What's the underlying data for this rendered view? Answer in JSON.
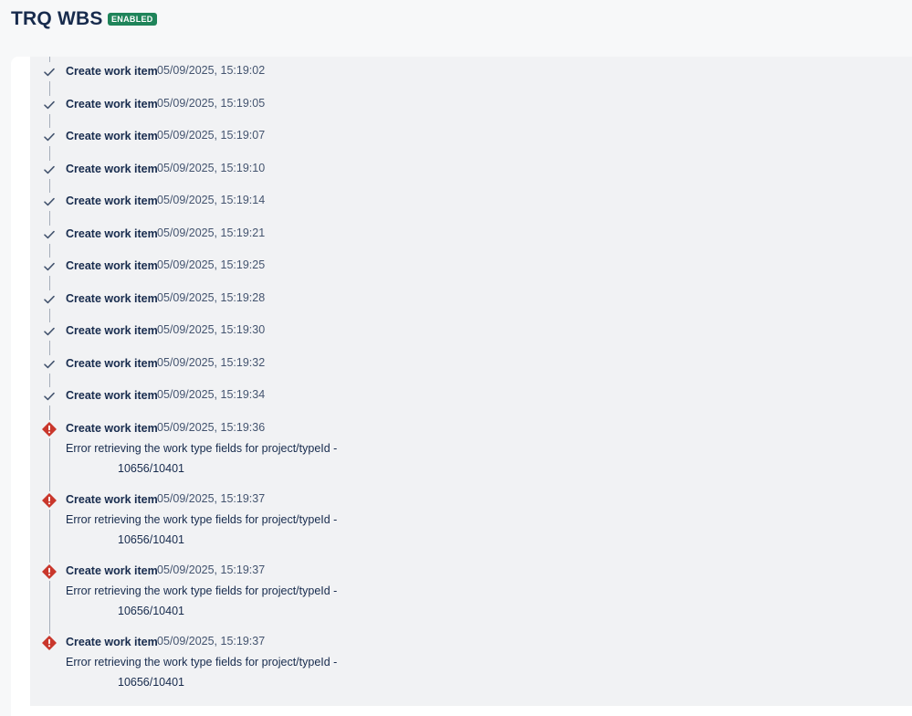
{
  "header": {
    "title": "TRQ WBS",
    "status": "ENABLED"
  },
  "log": {
    "entries": [
      {
        "status": "success",
        "action": "Create work item",
        "timestamp": "05/09/2025, 15:19:02"
      },
      {
        "status": "success",
        "action": "Create work item",
        "timestamp": "05/09/2025, 15:19:05"
      },
      {
        "status": "success",
        "action": "Create work item",
        "timestamp": "05/09/2025, 15:19:07"
      },
      {
        "status": "success",
        "action": "Create work item",
        "timestamp": "05/09/2025, 15:19:10"
      },
      {
        "status": "success",
        "action": "Create work item",
        "timestamp": "05/09/2025, 15:19:14"
      },
      {
        "status": "success",
        "action": "Create work item",
        "timestamp": "05/09/2025, 15:19:21"
      },
      {
        "status": "success",
        "action": "Create work item",
        "timestamp": "05/09/2025, 15:19:25"
      },
      {
        "status": "success",
        "action": "Create work item",
        "timestamp": "05/09/2025, 15:19:28"
      },
      {
        "status": "success",
        "action": "Create work item",
        "timestamp": "05/09/2025, 15:19:30"
      },
      {
        "status": "success",
        "action": "Create work item",
        "timestamp": "05/09/2025, 15:19:32"
      },
      {
        "status": "success",
        "action": "Create work item",
        "timestamp": "05/09/2025, 15:19:34"
      },
      {
        "status": "error",
        "action": "Create work item",
        "timestamp": "05/09/2025, 15:19:36",
        "error_line1": "Error retrieving the work type fields for project/typeId -",
        "error_line2": "10656/10401"
      },
      {
        "status": "error",
        "action": "Create work item",
        "timestamp": "05/09/2025, 15:19:37",
        "error_line1": "Error retrieving the work type fields for project/typeId -",
        "error_line2": "10656/10401"
      },
      {
        "status": "error",
        "action": "Create work item",
        "timestamp": "05/09/2025, 15:19:37",
        "error_line1": "Error retrieving the work type fields for project/typeId -",
        "error_line2": "10656/10401"
      },
      {
        "status": "error",
        "action": "Create work item",
        "timestamp": "05/09/2025, 15:19:37",
        "error_line1": "Error retrieving the work type fields for project/typeId -",
        "error_line2": "10656/10401"
      }
    ]
  },
  "icons": {
    "success": "checkmark-icon",
    "error": "error-icon"
  },
  "colors": {
    "badge": "#1f845a",
    "error": "#c9372c",
    "check": "#44546f",
    "title": "#172b4d"
  }
}
